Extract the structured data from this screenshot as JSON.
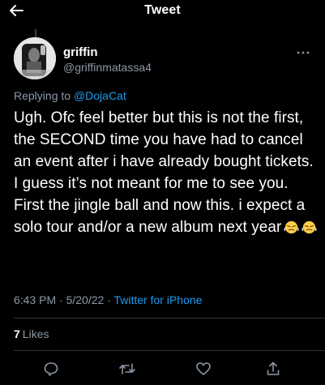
{
  "header": {
    "title": "Tweet",
    "back_icon": "arrow-left-icon"
  },
  "author": {
    "name": "griffin",
    "handle": "@griffinmatassa4"
  },
  "reply": {
    "prefix": "Replying to ",
    "mention": "@DojaCat"
  },
  "tweet": {
    "text": "Ugh. Ofc feel better but this is not the first, the SECOND time you have had to cancel an event after i have already bought tickets. I guess it’s not meant for me to see you. First the jingle ball and now this. i expect a solo tour and/or a new album next year",
    "emojis": [
      "steaming-face-emoji",
      "steaming-face-emoji"
    ]
  },
  "meta": {
    "time": "6:43 PM",
    "date": "5/20/22",
    "separator": "·",
    "source": "Twitter for iPhone"
  },
  "stats": {
    "likes_count": "7",
    "likes_label": "Likes"
  },
  "actions": [
    "reply-icon",
    "retweet-icon",
    "like-icon",
    "share-icon"
  ],
  "colors": {
    "background": "#000000",
    "text": "#ffffff",
    "secondary": "#8b98a5",
    "accent": "#1d9bf0",
    "divider": "#2f3336"
  }
}
